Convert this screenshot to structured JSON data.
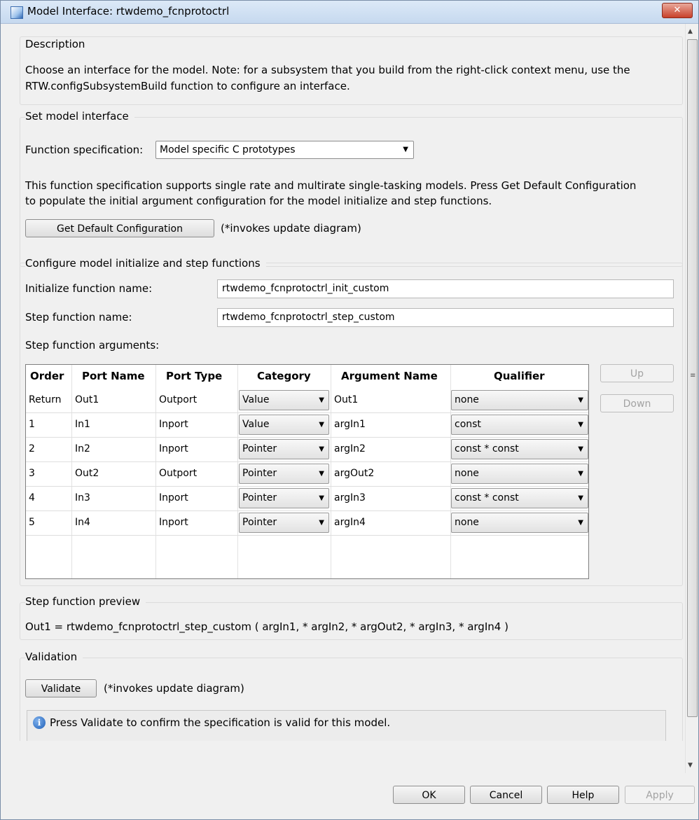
{
  "window": {
    "title": "Model Interface: rtwdemo_fcnprotoctrl",
    "close_glyph": "✕"
  },
  "description": {
    "group_title": "Description",
    "line1": "Choose an interface for the model. Note: for a subsystem that you build from the right-click context menu, use the",
    "line2": "RTW.configSubsystemBuild function to configure an interface."
  },
  "set_interface": {
    "group_title": "Set model interface",
    "function_spec_label": "Function specification:",
    "function_spec_value": "Model specific C prototypes",
    "info_line1": "This function specification supports single rate and multirate single-tasking models.  Press Get Default Configuration",
    "info_line2": "to populate the initial argument configuration for the model initialize and step functions.",
    "get_default_button": "Get Default Configuration",
    "get_default_note": "(*invokes update diagram)"
  },
  "configure": {
    "group_title": "Configure model initialize and step functions",
    "init_label": "Initialize function name:",
    "init_value": "rtwdemo_fcnprotoctrl_init_custom",
    "step_label": "Step function name:",
    "step_value": "rtwdemo_fcnprotoctrl_step_custom",
    "args_label": "Step function arguments:",
    "up_button": "Up",
    "down_button": "Down",
    "table": {
      "headers": [
        "Order",
        "Port Name",
        "Port Type",
        "Category",
        "Argument Name",
        "Qualifier"
      ],
      "rows": [
        [
          "Return",
          "Out1",
          "Outport",
          "Value",
          "Out1",
          "none"
        ],
        [
          "1",
          "In1",
          "Inport",
          "Value",
          "argIn1",
          "const"
        ],
        [
          "2",
          "In2",
          "Inport",
          "Pointer",
          "argIn2",
          "const * const"
        ],
        [
          "3",
          "Out2",
          "Outport",
          "Pointer",
          "argOut2",
          "none"
        ],
        [
          "4",
          "In3",
          "Inport",
          "Pointer",
          "argIn3",
          "const * const"
        ],
        [
          "5",
          "In4",
          "Inport",
          "Pointer",
          "argIn4",
          "none"
        ]
      ]
    }
  },
  "preview": {
    "group_title": "Step function preview",
    "text": "Out1 = rtwdemo_fcnprotoctrl_step_custom ( argIn1, * argIn2, * argOut2, * argIn3, * argIn4 )"
  },
  "validation": {
    "group_title": "Validation",
    "validate_button": "Validate",
    "note": "(*invokes update diagram)",
    "message": "Press Validate to confirm the specification is valid for this model."
  },
  "footer": {
    "ok": "OK",
    "cancel": "Cancel",
    "help": "Help",
    "apply": "Apply"
  }
}
